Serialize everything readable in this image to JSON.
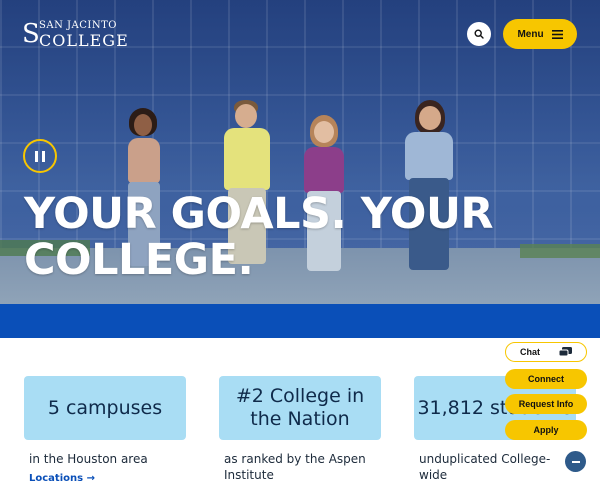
{
  "brand": {
    "top": "SAN JACINTO",
    "bottom": "COLLEGE",
    "mark": "S"
  },
  "header": {
    "menu_label": "Menu",
    "search_icon": "search-icon",
    "menu_icon": "hamburger-icon"
  },
  "hero": {
    "headline": "YOUR GOALS. YOUR COLLEGE.",
    "pause_icon": "pause-icon",
    "accent_color": "#f7c600",
    "band_color": "#0a4fb8"
  },
  "stats": [
    {
      "value": "5 campuses",
      "description": "in the Houston area",
      "link": "Locations"
    },
    {
      "value": "#2 College in the Nation",
      "description": "as ranked by the Aspen Institute"
    },
    {
      "value": "31,812 students",
      "description": "unduplicated College-wide"
    }
  ],
  "side_actions": {
    "chat": "Chat",
    "connect": "Connect",
    "request_info": "Request Info",
    "apply": "Apply",
    "chat_icon": "chat-bubble-icon",
    "scroll_icon": "minus-icon"
  }
}
